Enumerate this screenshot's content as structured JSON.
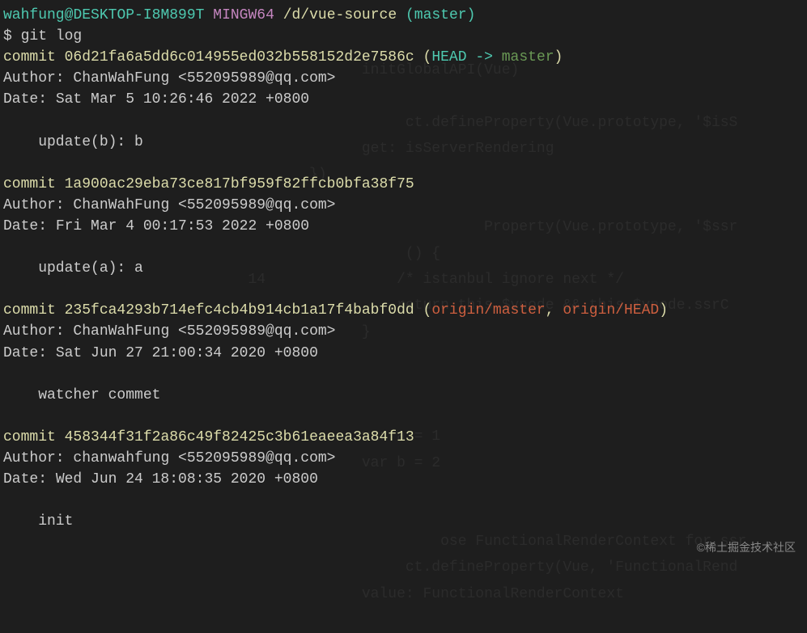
{
  "prompt": {
    "user": "wahfung",
    "at": "@",
    "host": "DESKTOP-I8M899T",
    "env": "MINGW64",
    "path": "/d/vue-source",
    "branch": "(master)",
    "dollar": "$",
    "command": "git log"
  },
  "commits": [
    {
      "commit_word": "commit",
      "hash": "06d21fa6a5dd6c014955ed032b558152d2e7586c",
      "refs_open": " (",
      "head": "HEAD -> ",
      "master": "master",
      "refs_close": ")",
      "author_label": "Author: ",
      "author": "ChanWahFung <552095989@qq.com>",
      "date_label": "Date:   ",
      "date": "Sat Mar 5 10:26:46 2022 +0800",
      "message": "update(b): b"
    },
    {
      "commit_word": "commit",
      "hash": "1a900ac29eba73ce817bf959f82ffcb0bfa38f75",
      "author_label": "Author: ",
      "author": "ChanWahFung <552095989@qq.com>",
      "date_label": "Date:   ",
      "date": "Fri Mar 4 00:17:53 2022 +0800",
      "message": "update(a): a"
    },
    {
      "commit_word": "commit",
      "hash": "235fca4293b714efc4cb4b914cb1a17f4babf0dd",
      "refs_open": " (",
      "origin1": "origin/master",
      "refs_sep": ", ",
      "origin2": "origin/HEAD",
      "refs_close": ")",
      "author_label": "Author: ",
      "author": "ChanWahFung <552095989@qq.com>",
      "date_label": "Date:   ",
      "date": "Sat Jun 27 21:00:34 2020 +0800",
      "message": "watcher commet"
    },
    {
      "commit_word": "commit",
      "hash": "458344f31f2a86c49f82425c3b61eaeea3a84f13",
      "author_label": "Author: ",
      "author": "chanwahfung <552095989@qq.com>",
      "date_label": "Date:   ",
      "date": "Wed Jun 24 18:08:35 2020 +0800",
      "message": "init"
    }
  ],
  "watermark": "©稀土掘金技术社区",
  "bg_text": "                                         initGlobalAPI(Vue)\n\n                                              ct.defineProperty(Vue.prototype, '$isS\n                                         get: isServerRendering\n                                   })\n\n                                                       Property(Vue.prototype, '$ssr\n                                              () {\n                            14               /* istanbul ignore next */\n                                             return this.$vnode && this.$vnode.ssrC\n                                         }\n\n\n\n                                         var a = 1\n                                         var b = 2\n\n\n                                                  ose FunctionalRenderContext for ssr\n                                              ct.defineProperty(Vue, 'FunctionalRend\n                                         value: FunctionalRenderContext"
}
